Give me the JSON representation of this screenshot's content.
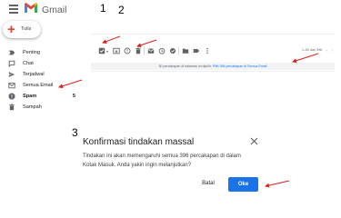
{
  "app": {
    "title": "Gmail"
  },
  "steps": {
    "one": "1",
    "two": "2",
    "three": "3"
  },
  "compose": {
    "label": "Tulis"
  },
  "sidebar": {
    "items": [
      {
        "label": "Penting",
        "count": ""
      },
      {
        "label": "Chat",
        "count": ""
      },
      {
        "label": "Terjadwal",
        "count": ""
      },
      {
        "label": "Semua Email",
        "count": ""
      },
      {
        "label": "Spam",
        "count": "5"
      },
      {
        "label": "Sampah",
        "count": ""
      }
    ]
  },
  "toolbar": {
    "pager": "1–50 dari 396",
    "notice_text": "50 percakapan di halaman ini dipilih.",
    "notice_link": "Pilih 396 percakapan di Semua Email"
  },
  "dialog": {
    "title": "Konfirmasi tindakan massal",
    "body": "Tindakan ini akan memengaruhi semua 396 percakapan di dalam Kotak Masuk. Anda yakin ingin melanjutkan?",
    "cancel_label": "Batal",
    "ok_label": "Oke"
  },
  "colors": {
    "annotation": "#e0201b",
    "primary": "#1a73e8",
    "gmail_red": "#ea4335"
  },
  "icons": [
    "menu-icon",
    "gmail-logo",
    "plus-icon",
    "label-important-icon",
    "chat-icon",
    "schedule-icon",
    "all-mail-icon",
    "spam-icon",
    "trash-icon",
    "checkbox-icon",
    "archive-icon",
    "report-icon",
    "delete-icon",
    "mail-icon",
    "snooze-icon",
    "more-icon",
    "close-icon"
  ]
}
